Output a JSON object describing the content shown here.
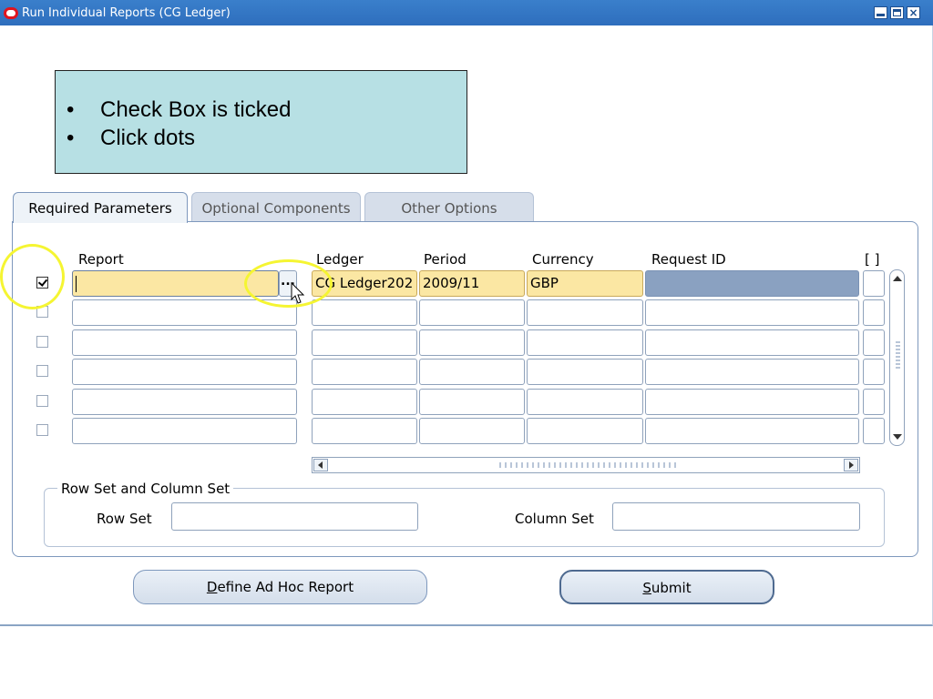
{
  "window": {
    "title": "Run Individual Reports (CG Ledger)"
  },
  "callout": {
    "items": [
      "Check Box is ticked",
      "Click dots"
    ],
    "bullet": "•"
  },
  "tabs": [
    {
      "label": "Required Parameters",
      "active": true
    },
    {
      "label": "Optional Components",
      "active": false
    },
    {
      "label": "Other Options",
      "active": false
    }
  ],
  "table": {
    "headers": {
      "report": "Report",
      "ledger": "Ledger",
      "period": "Period",
      "currency": "Currency",
      "request_id": "Request ID",
      "flex": "[ ]"
    },
    "lov_glyph": "...",
    "rows": [
      {
        "checked": true,
        "report": "",
        "ledger": "CG Ledger202",
        "period": "2009/11",
        "currency": "GBP",
        "request_id": ""
      },
      {
        "checked": false,
        "report": "",
        "ledger": "",
        "period": "",
        "currency": "",
        "request_id": ""
      },
      {
        "checked": false,
        "report": "",
        "ledger": "",
        "period": "",
        "currency": "",
        "request_id": ""
      },
      {
        "checked": false,
        "report": "",
        "ledger": "",
        "period": "",
        "currency": "",
        "request_id": ""
      },
      {
        "checked": false,
        "report": "",
        "ledger": "",
        "period": "",
        "currency": "",
        "request_id": ""
      },
      {
        "checked": false,
        "report": "",
        "ledger": "",
        "period": "",
        "currency": "",
        "request_id": ""
      }
    ]
  },
  "row_column_set": {
    "group_label": "Row Set and Column Set",
    "row_set_label": "Row Set",
    "row_set_value": "",
    "column_set_label": "Column Set",
    "column_set_value": ""
  },
  "buttons": {
    "define_prefix": "D",
    "define_rest": "efine Ad Hoc Report",
    "submit_prefix": "S",
    "submit_rest": "ubmit"
  },
  "colors": {
    "title_bar": "#2e6ebd",
    "callout_bg": "#b7e0e4",
    "required_field": "#fbe7a3",
    "request_id_field": "#8aa1c1",
    "annotation": "#f5f532"
  }
}
